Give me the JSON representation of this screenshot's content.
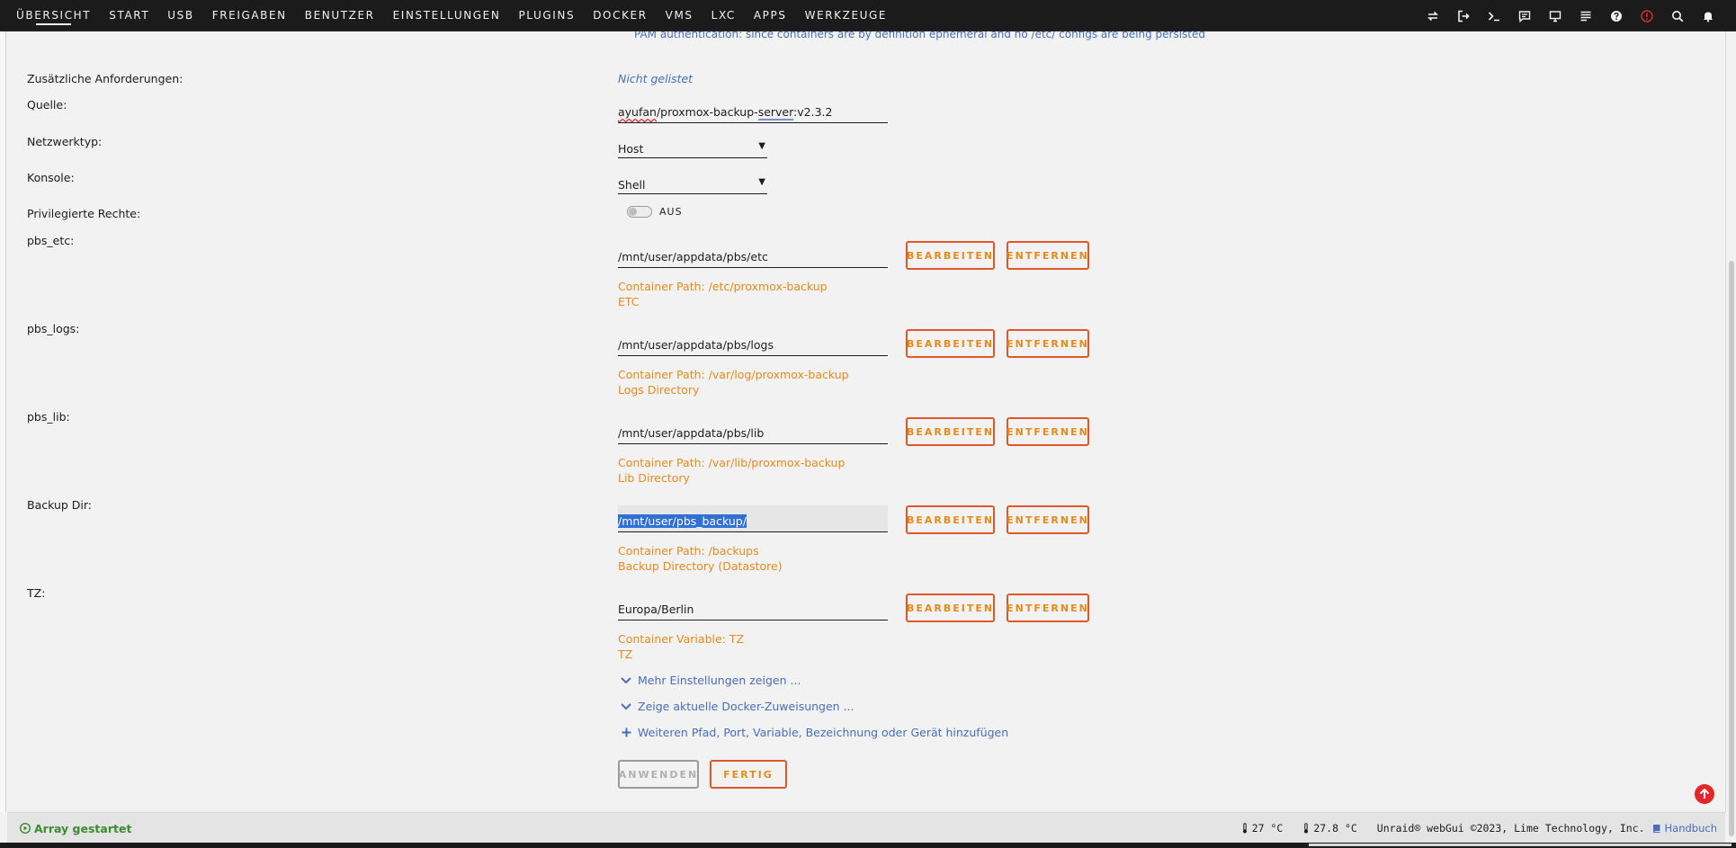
{
  "nav": {
    "items": [
      "ÜBERSICHT",
      "START",
      "USB",
      "FREIGABEN",
      "BENUTZER",
      "EINSTELLUNGEN",
      "PLUGINS",
      "DOCKER",
      "VMS",
      "LXC",
      "APPS",
      "WERKZEUGE"
    ],
    "icons": [
      "switch-icon",
      "logout-icon",
      "terminal-icon",
      "feedback-icon",
      "monitor-icon",
      "log-icon",
      "help-icon",
      "alert-icon",
      "search-icon",
      "bell-icon"
    ]
  },
  "top_cut_text": "PAM authentication: since containers are by definition ephemeral and no /etc/ configs are being persisted",
  "form": {
    "extra_req_label": "Zusätzliche Anforderungen:",
    "extra_req_value": "Nicht gelistet",
    "source_label": "Quelle:",
    "source_parts": [
      "ayufan",
      "/proxmox-backup-",
      "server",
      ":v2.3.2"
    ],
    "nettype_label": "Netzwerktyp:",
    "nettype_value": "Host",
    "console_label": "Konsole:",
    "console_value": "Shell",
    "priv_label": "Privilegierte Rechte:",
    "priv_toggle": "AUS",
    "edit_button": "BEARBEITEN",
    "remove_button": "ENTFERNEN",
    "paths": [
      {
        "label": "pbs_etc:",
        "value": "/mnt/user/appdata/pbs/etc",
        "hint1": "Container Path: /etc/proxmox-backup",
        "hint2": "ETC"
      },
      {
        "label": "pbs_logs:",
        "value": "/mnt/user/appdata/pbs/logs",
        "hint1": "Container Path: /var/log/proxmox-backup",
        "hint2": "Logs Directory"
      },
      {
        "label": "pbs_lib:",
        "value": "/mnt/user/appdata/pbs/lib",
        "hint1": "Container Path: /var/lib/proxmox-backup",
        "hint2": "Lib Directory"
      },
      {
        "label": "Backup Dir:",
        "value": "/mnt/user/pbs_backup/",
        "hint1": "Container Path: /backups",
        "hint2": "Backup Directory (Datastore)"
      },
      {
        "label": "TZ:",
        "value": "Europa/Berlin",
        "hint1": "Container Variable: TZ",
        "hint2": "TZ"
      }
    ],
    "more_settings": "Mehr Einstellungen zeigen ...",
    "docker_mappings": "Zeige aktuelle Docker-Zuweisungen ...",
    "add_more": "Weiteren Pfad, Port, Variable, Bezeichnung oder Gerät hinzufügen",
    "apply_button": "ANWENDEN",
    "done_button": "FERTIG"
  },
  "footer": {
    "array_status": "Array gestartet",
    "temp1": "27 °C",
    "temp2": "27.8 °C",
    "copyright": "Unraid® webGui ©2023, Lime Technology, Inc.",
    "manual": "Handbuch"
  },
  "colors": {
    "accent_orange": "#e68a1a",
    "button_border": "#e0582a",
    "link_blue": "#486dba",
    "status_green": "#3a8c2f",
    "nav_bg": "#1c1b1b"
  }
}
